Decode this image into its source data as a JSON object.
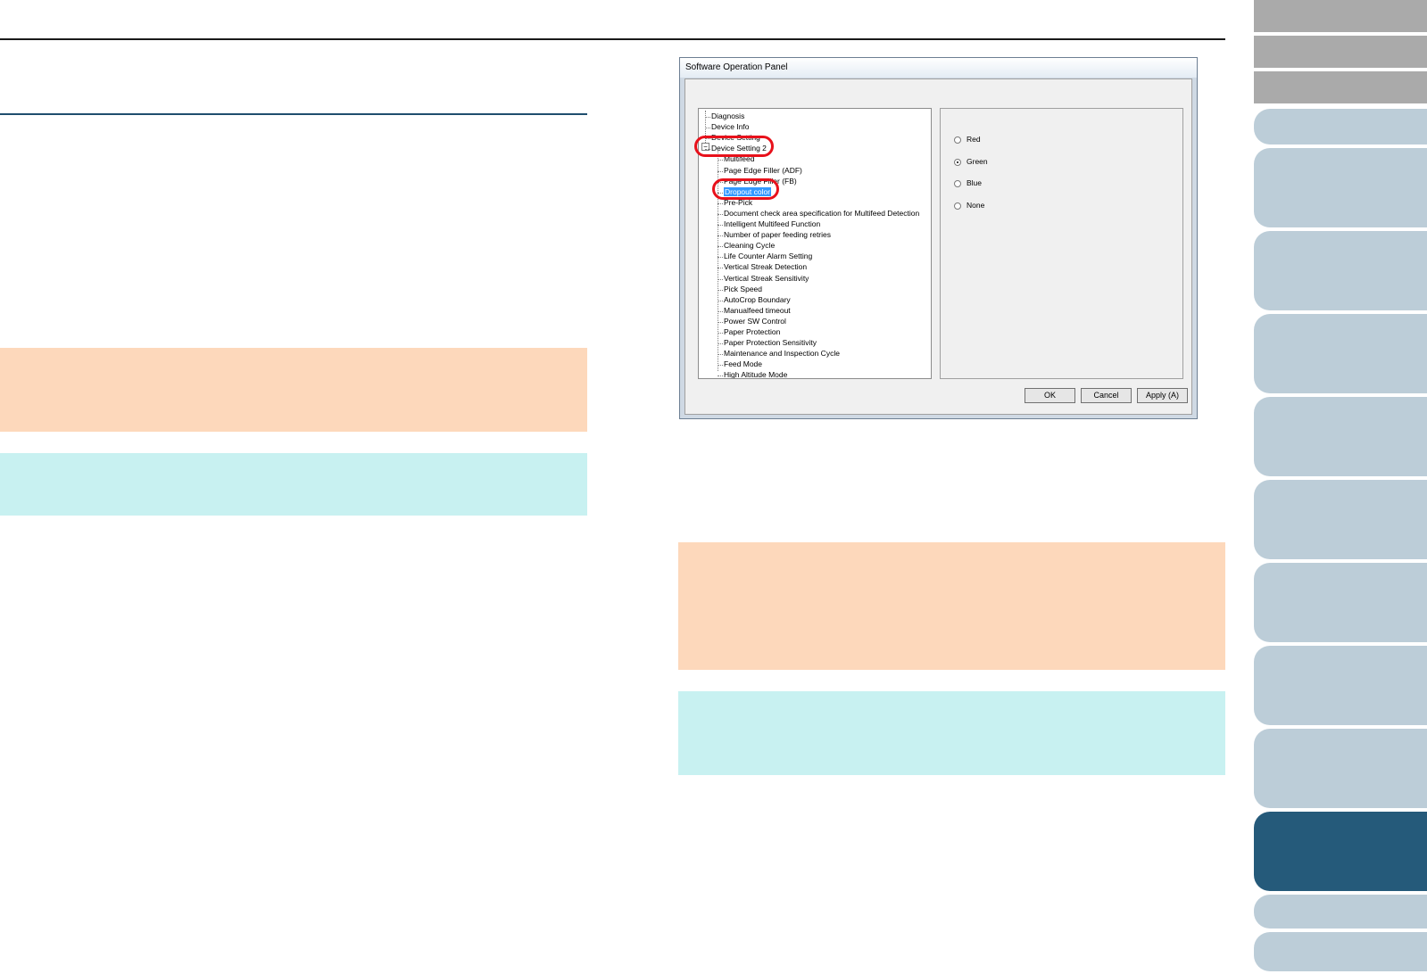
{
  "dialog": {
    "title": "Software Operation Panel",
    "tree": [
      {
        "label": "Diagnosis"
      },
      {
        "label": "Device Info"
      },
      {
        "label": "Device Setting"
      },
      {
        "label": "Device Setting 2"
      },
      {
        "label": "Multifeed"
      },
      {
        "label": "Page Edge Filler (ADF)"
      },
      {
        "label": "Page Edge Filler (FB)"
      },
      {
        "label": "Dropout color"
      },
      {
        "label": "Pre-Pick"
      },
      {
        "label": "Document check area specification for Multifeed Detection"
      },
      {
        "label": "Intelligent Multifeed Function"
      },
      {
        "label": "Number of paper feeding retries"
      },
      {
        "label": "Cleaning Cycle"
      },
      {
        "label": "Life Counter Alarm Setting"
      },
      {
        "label": "Vertical Streak Detection"
      },
      {
        "label": "Vertical Streak Sensitivity"
      },
      {
        "label": "Pick Speed"
      },
      {
        "label": "AutoCrop Boundary"
      },
      {
        "label": "Manualfeed timeout"
      },
      {
        "label": "Power SW Control"
      },
      {
        "label": "Paper Protection"
      },
      {
        "label": "Paper Protection Sensitivity"
      },
      {
        "label": "Maintenance and Inspection Cycle"
      },
      {
        "label": "Feed Mode"
      },
      {
        "label": "High Altitude Mode"
      }
    ],
    "options": [
      {
        "label": "Red",
        "checked": false
      },
      {
        "label": "Green",
        "checked": true
      },
      {
        "label": "Blue",
        "checked": false
      },
      {
        "label": "None",
        "checked": false
      }
    ],
    "buttons": {
      "ok": "OK",
      "cancel": "Cancel",
      "apply": "Apply (A)"
    }
  },
  "colors": {
    "caution": "#fdd8bb",
    "hint": "#c8f1f1",
    "tab_active": "#255a7a",
    "tab": "#bccdd8",
    "tab_gray": "#aaaaaa",
    "highlight": "#e8111b"
  }
}
